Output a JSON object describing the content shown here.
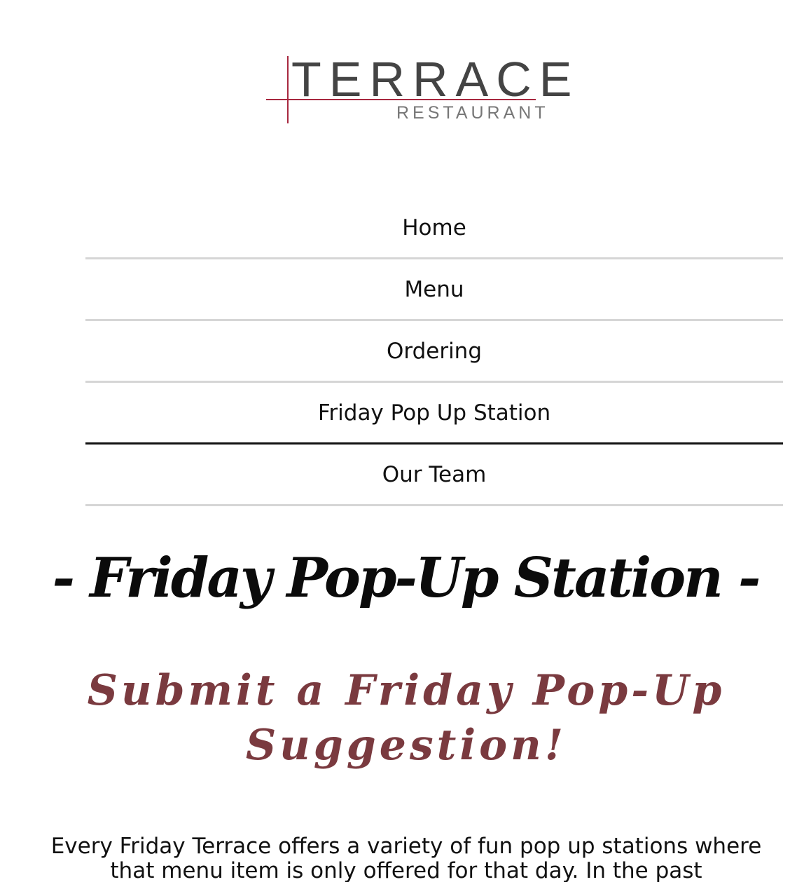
{
  "logo": {
    "title": "TERRACE",
    "subtitle": "RESTAURANT",
    "accent_color": "#a8283f"
  },
  "nav": {
    "items": [
      {
        "label": "Home"
      },
      {
        "label": "Menu"
      },
      {
        "label": "Ordering"
      },
      {
        "label": "Friday Pop Up Station"
      },
      {
        "label": "Our Team"
      }
    ],
    "active": "Friday Pop Up Station"
  },
  "main": {
    "title": "- Friday Pop-Up Station -",
    "subtitle": "Submit a Friday Pop-Up Suggestion!",
    "subtitle_color": "#7a3a3f",
    "intro": "Every Friday Terrace offers a variety of fun pop up stations where that menu item is only offered for that day. In the past"
  }
}
